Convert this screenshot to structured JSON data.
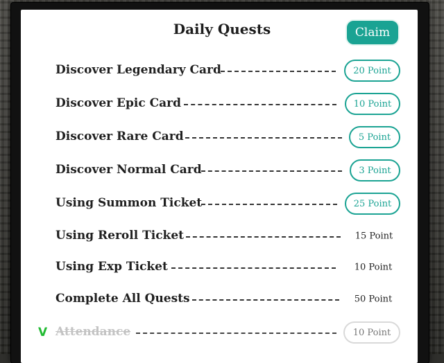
{
  "title": "Daily Quests",
  "claim_label": "Claim",
  "quests": [
    {
      "name": "Discover Legendary Card",
      "reward": "20 Point"
    },
    {
      "name": "Discover Epic Card",
      "reward": "10 Point"
    },
    {
      "name": "Discover Rare Card",
      "reward": "5 Point"
    },
    {
      "name": "Discover Normal Card",
      "reward": "3 Point"
    },
    {
      "name": "Using Summon Ticket",
      "reward": "25 Point"
    },
    {
      "name": "Using Reroll Ticket",
      "reward": "15 Point"
    },
    {
      "name": "Using Exp Ticket",
      "reward": "10 Point"
    },
    {
      "name": "Complete All Quests",
      "reward": "50 Point"
    },
    {
      "name": "Attendance",
      "reward": "10 Point",
      "check": "V"
    }
  ],
  "colors": {
    "accent": "#1aa393",
    "check": "#22bb33"
  }
}
